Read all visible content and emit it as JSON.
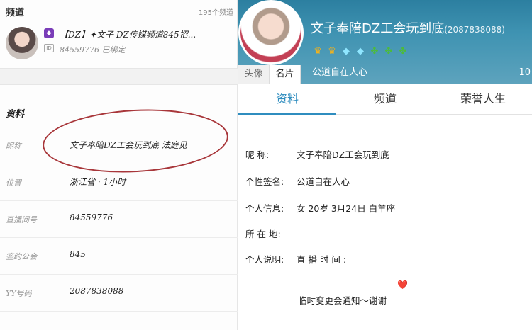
{
  "left": {
    "header_title": "频道",
    "header_count": "195个频道",
    "vip_icon": "vip-gem-icon",
    "name": "【DZ】✦文子  DZ传媒频道845招...",
    "id_label": "ID",
    "id_value": "84559776  已绑定",
    "section_title": "资料",
    "rows": [
      {
        "key": "昵称",
        "value": "文子奉陪DZ工会玩到底 法庭见"
      },
      {
        "key": "位置",
        "value": "浙江省 · 1小时"
      },
      {
        "key": "直播间号",
        "value": "84559776"
      },
      {
        "key": "签约公会",
        "value": "845"
      },
      {
        "key": "YY号码",
        "value": "2087838088"
      }
    ],
    "annotation_color": "#a8363a"
  },
  "right": {
    "title": "文子奉陪DZ工会玩到底",
    "yy_number": "(2087838088)",
    "badges": [
      "crown-icon",
      "crown-icon",
      "diamond-icon",
      "diamond-icon",
      "leaf-icon",
      "leaf-icon",
      "leaf-icon"
    ],
    "small_tabs": [
      "头像",
      "名片"
    ],
    "signature_banner": "公道自在人心",
    "banner_right_text": "10",
    "nav_tabs": [
      "资料",
      "频道",
      "荣誉人生"
    ],
    "info": [
      {
        "key": "昵      称:",
        "value": "文子奉陪DZ工会玩到底"
      },
      {
        "key": "个性签名:",
        "value": "公道自在人心"
      },
      {
        "key": "个人信息:",
        "value": "女   20岁   3月24日   白羊座"
      },
      {
        "key": "所 在 地:",
        "value": ""
      },
      {
        "key": "个人说明:",
        "value": "直 播 时 间 :"
      }
    ],
    "heart": "❤️",
    "notice": "临时变更会通知～谢谢",
    "accent_color": "#2f8dbf",
    "banner_color": "#3f93b2"
  }
}
